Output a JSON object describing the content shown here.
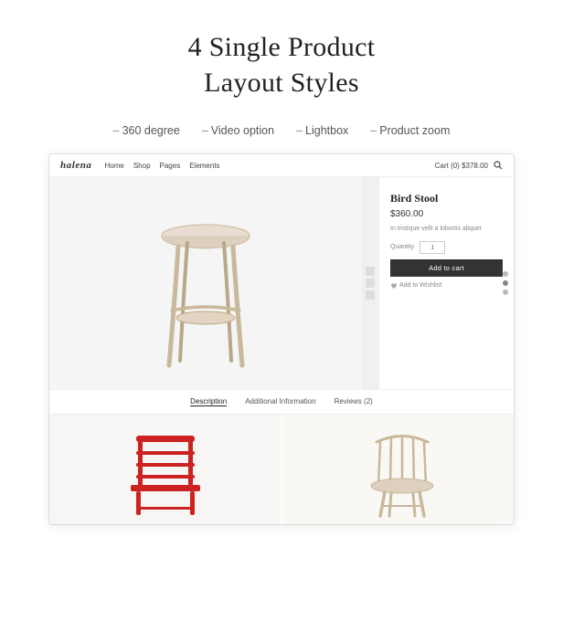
{
  "page": {
    "title": "4 Single Product",
    "title_line2": "Layout Styles",
    "features": [
      {
        "label": "360 degree",
        "dash": "–"
      },
      {
        "label": "Video option",
        "dash": "–"
      },
      {
        "label": "Lightbox",
        "dash": "–"
      },
      {
        "label": "Product zoom",
        "dash": "–"
      }
    ]
  },
  "mockup": {
    "navbar": {
      "logo": "halena",
      "links": [
        "Home",
        "Shop",
        "Pages",
        "Elements"
      ],
      "cart_text": "Cart (0) $378.00",
      "search_icon": "search"
    },
    "product": {
      "name": "Bird Stool",
      "price": "$360.00",
      "description": "In tristique velit a lobortis aliquet",
      "quantity_label": "Quantity",
      "quantity_value": "1",
      "add_to_cart_label": "Add to cart",
      "wishlist_label": "Add to Wishlist"
    },
    "tabs": [
      {
        "label": "Description",
        "active": true
      },
      {
        "label": "Additional Information",
        "active": false
      },
      {
        "label": "Reviews (2)",
        "active": false
      }
    ]
  }
}
